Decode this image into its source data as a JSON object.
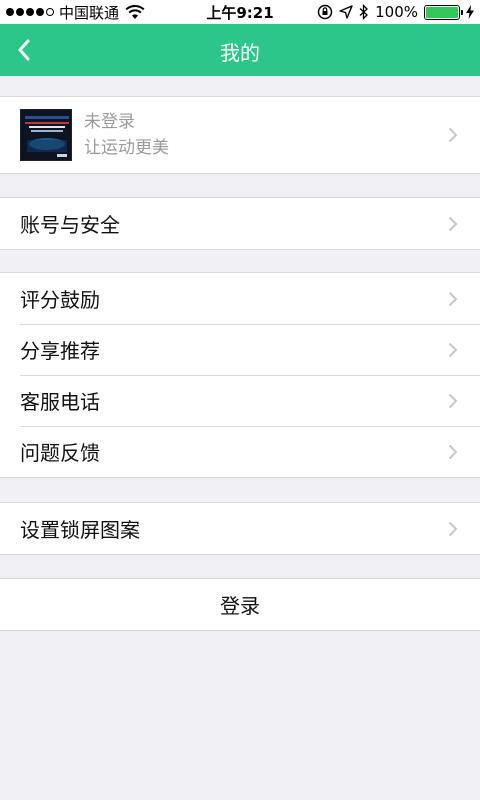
{
  "status_bar": {
    "carrier": "中国联通",
    "time": "上午9:21",
    "battery_text": "100%",
    "battery_level": 1.0,
    "battery_color": "#34c759"
  },
  "nav": {
    "back_icon": "chevron-left-icon",
    "title": "我的",
    "background": "#2dc689"
  },
  "profile": {
    "status": "未登录",
    "slogan": "让运动更美"
  },
  "groups": {
    "account": [
      {
        "label": "账号与安全"
      }
    ],
    "misc": [
      {
        "label": "评分鼓励"
      },
      {
        "label": "分享推荐"
      },
      {
        "label": "客服电话"
      },
      {
        "label": "问题反馈"
      }
    ],
    "lock": [
      {
        "label": "设置锁屏图案"
      }
    ]
  },
  "login_label": "登录"
}
